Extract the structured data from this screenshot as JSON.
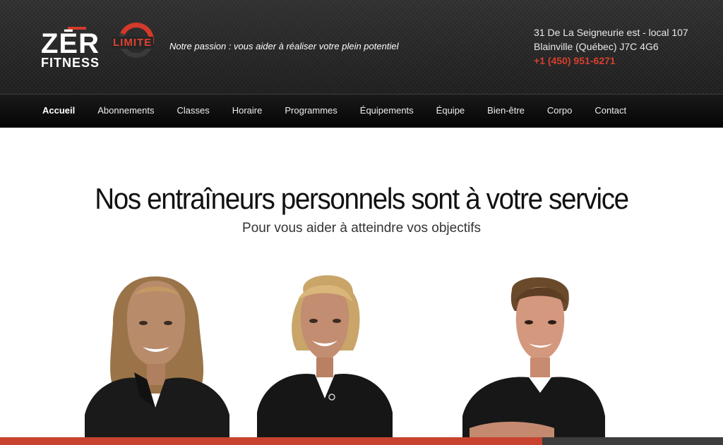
{
  "brand": {
    "logo_text_zero": "ZĒR",
    "logo_text_limite": "LIMITE",
    "logo_text_fitness": "FITNESS",
    "tagline": "Notre passion : vous aider à réaliser votre plein potentiel",
    "accent_color": "#d23a2b"
  },
  "contact": {
    "address_line1": "31 De La Seigneurie est - local 107",
    "address_line2": "Blainville (Québec) J7C 4G6",
    "phone": "+1 (450) 951-6271"
  },
  "nav": {
    "items": [
      {
        "label": "Accueil",
        "active": true
      },
      {
        "label": "Abonnements"
      },
      {
        "label": "Classes"
      },
      {
        "label": "Horaire"
      },
      {
        "label": "Programmes"
      },
      {
        "label": "Équipements"
      },
      {
        "label": "Équipe"
      },
      {
        "label": "Bien-être"
      },
      {
        "label": "Corpo"
      },
      {
        "label": "Contact"
      }
    ]
  },
  "hero": {
    "title": "Nos entraîneurs personnels sont à votre service",
    "subtitle": "Pour vous aider à atteindre vos objectifs"
  },
  "slider_progress": 0.75
}
